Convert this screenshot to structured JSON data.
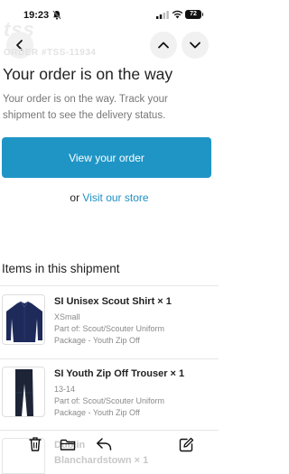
{
  "status_bar": {
    "time": "19:23",
    "battery": "72",
    "icons": [
      "bell-slash-icon",
      "cellular-signal-icon",
      "wifi-icon",
      "battery-icon"
    ]
  },
  "background": {
    "logo_text": "tss"
  },
  "nav": {
    "icons": [
      "chevron-left-icon",
      "chevron-up-icon",
      "chevron-down-icon"
    ]
  },
  "email": {
    "order_number": "ORDER #TSS-11934",
    "title": "Your order is on the way",
    "subtitle": "Your order is on the way. Track your shipment to see the delivery status.",
    "view_order_label": "View your order",
    "or_text": "or",
    "store_link": "Visit our store",
    "section_title": "Items in this shipment",
    "items": [
      {
        "title": "SI Unisex Scout Shirt × 1",
        "variant": "XSmall",
        "part_of_line1": "Part of: Scout/Scouter Uniform",
        "part_of_line2": "Package - Youth Zip Off"
      },
      {
        "title": "SI Youth Zip Off Trouser × 1",
        "variant": "13-14",
        "part_of_line1": "Part of: Scout/Scouter Uniform",
        "part_of_line2": "Package - Youth Zip Off"
      }
    ],
    "partial_item": {
      "line1": "Dublin",
      "line2": "Blanchardstown × 1"
    }
  },
  "toolbar": {
    "icons": [
      "trash-icon",
      "folder-icon",
      "reply-icon",
      "compose-icon"
    ]
  },
  "colors": {
    "accent": "#1f95c6",
    "link": "#1f8fc2",
    "shirt": "#1e2a5a",
    "trouser": "#1c2436"
  }
}
